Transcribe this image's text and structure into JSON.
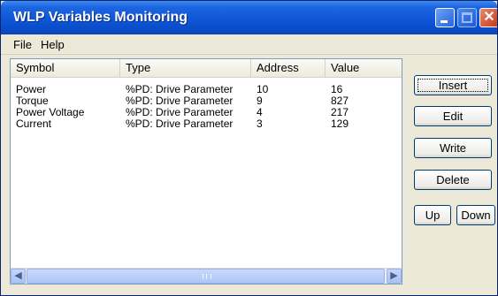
{
  "window": {
    "title": "WLP Variables Monitoring"
  },
  "menu": {
    "file": "File",
    "help": "Help"
  },
  "columns": [
    "Symbol",
    "Type",
    "Address",
    "Value"
  ],
  "rows": [
    {
      "symbol": "Power",
      "type": "%PD: Drive Parameter",
      "address": "10",
      "value": "16"
    },
    {
      "symbol": "Torque",
      "type": "%PD: Drive Parameter",
      "address": "9",
      "value": "827"
    },
    {
      "symbol": "Power Voltage",
      "type": "%PD: Drive Parameter",
      "address": "4",
      "value": "217"
    },
    {
      "symbol": "Current",
      "type": "%PD: Drive Parameter",
      "address": "3",
      "value": "129"
    }
  ],
  "buttons": {
    "insert": "Insert",
    "edit": "Edit",
    "write": "Write",
    "delete": "Delete",
    "up": "Up",
    "down": "Down"
  },
  "colors": {
    "titlebar": "#0f56d8",
    "close": "#c8381b",
    "face": "#ece9d8"
  }
}
